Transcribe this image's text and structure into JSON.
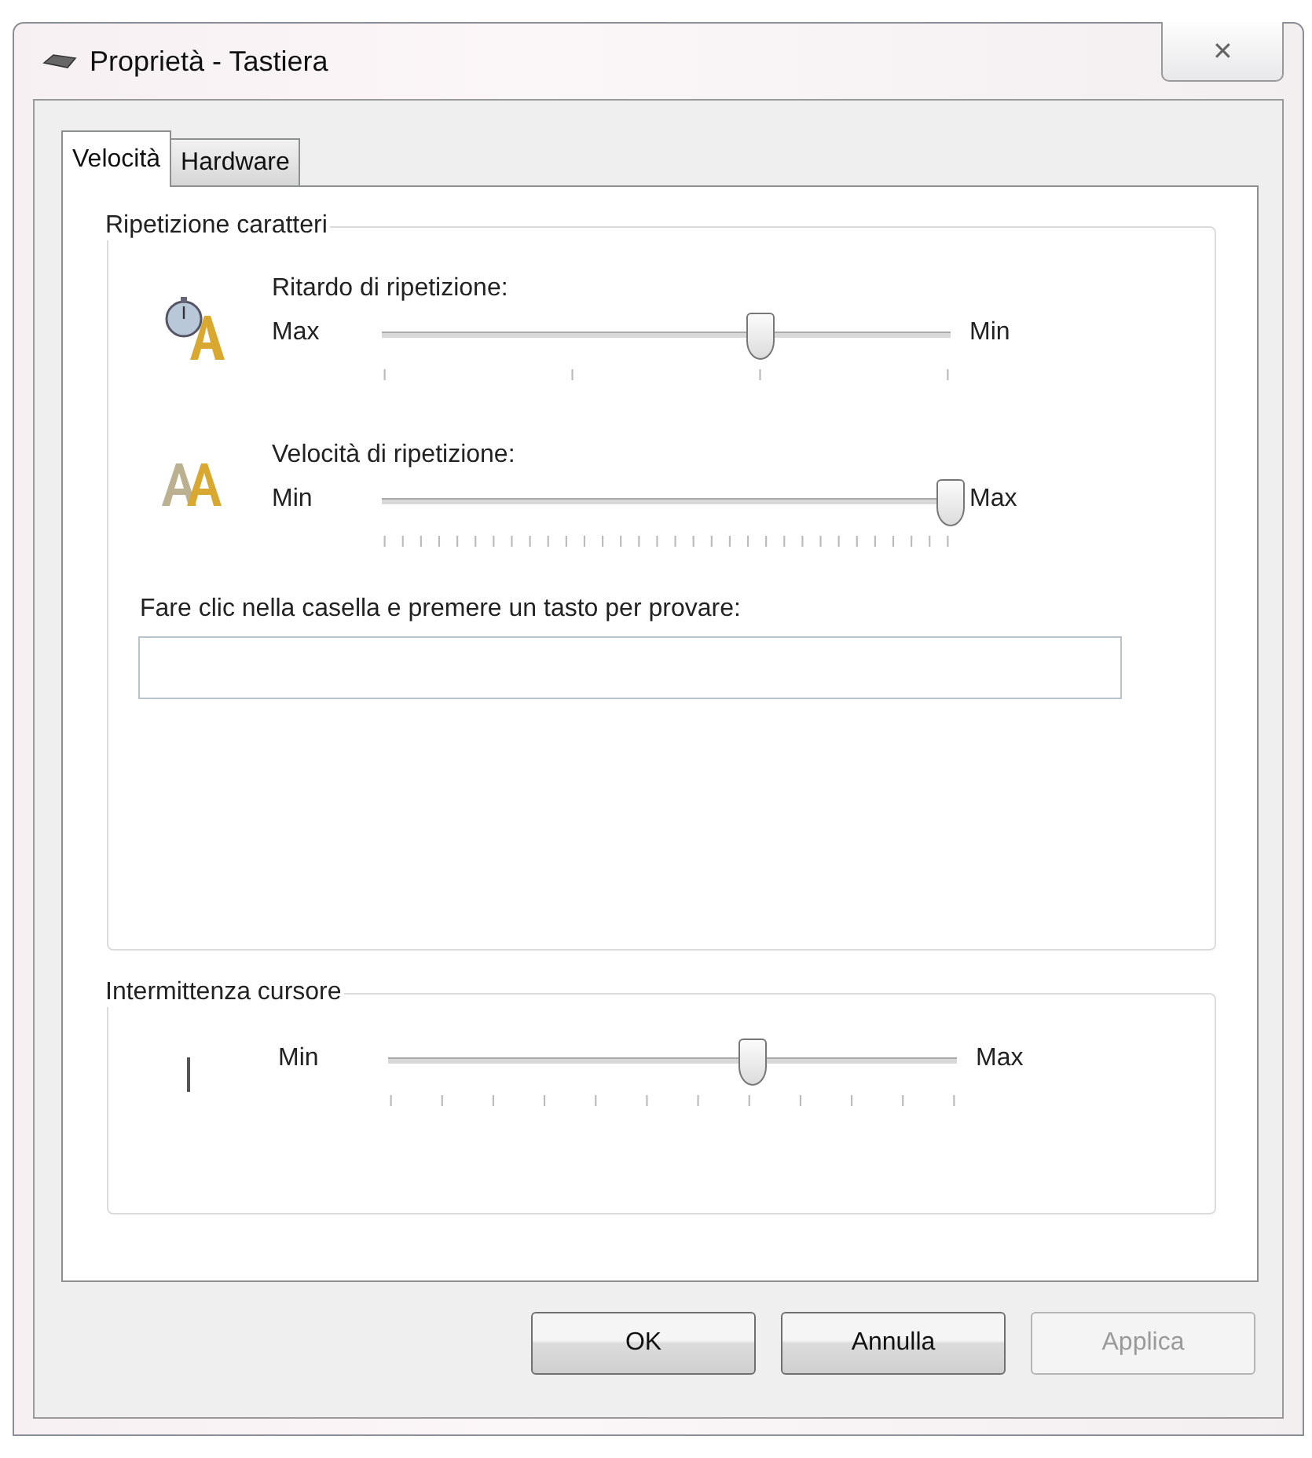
{
  "window": {
    "title": "Proprietà - Tastiera",
    "close": "✕"
  },
  "tabs": [
    {
      "label": "Velocità",
      "selected": true
    },
    {
      "label": "Hardware",
      "selected": false
    }
  ],
  "repeat_group": {
    "title": "Ripetizione caratteri",
    "sliders": [
      {
        "label": "Ritardo di ripetizione:",
        "left": "Max",
        "right": "Min",
        "level": 0.667
      },
      {
        "label": "Velocità di ripetizione:",
        "left": "Min",
        "right": "Max",
        "level": 1.0
      }
    ],
    "test": {
      "label": "Fare clic nella casella e premere un tasto per provare:"
    }
  },
  "blink_group": {
    "title": "Intermittenza cursore",
    "slider": {
      "left": "Min",
      "right": "Max",
      "level": 0.64
    }
  },
  "buttons": [
    {
      "label": "OK",
      "disabled": false
    },
    {
      "label": "Annulla",
      "disabled": false
    },
    {
      "label": "Applica",
      "disabled": true
    }
  ]
}
